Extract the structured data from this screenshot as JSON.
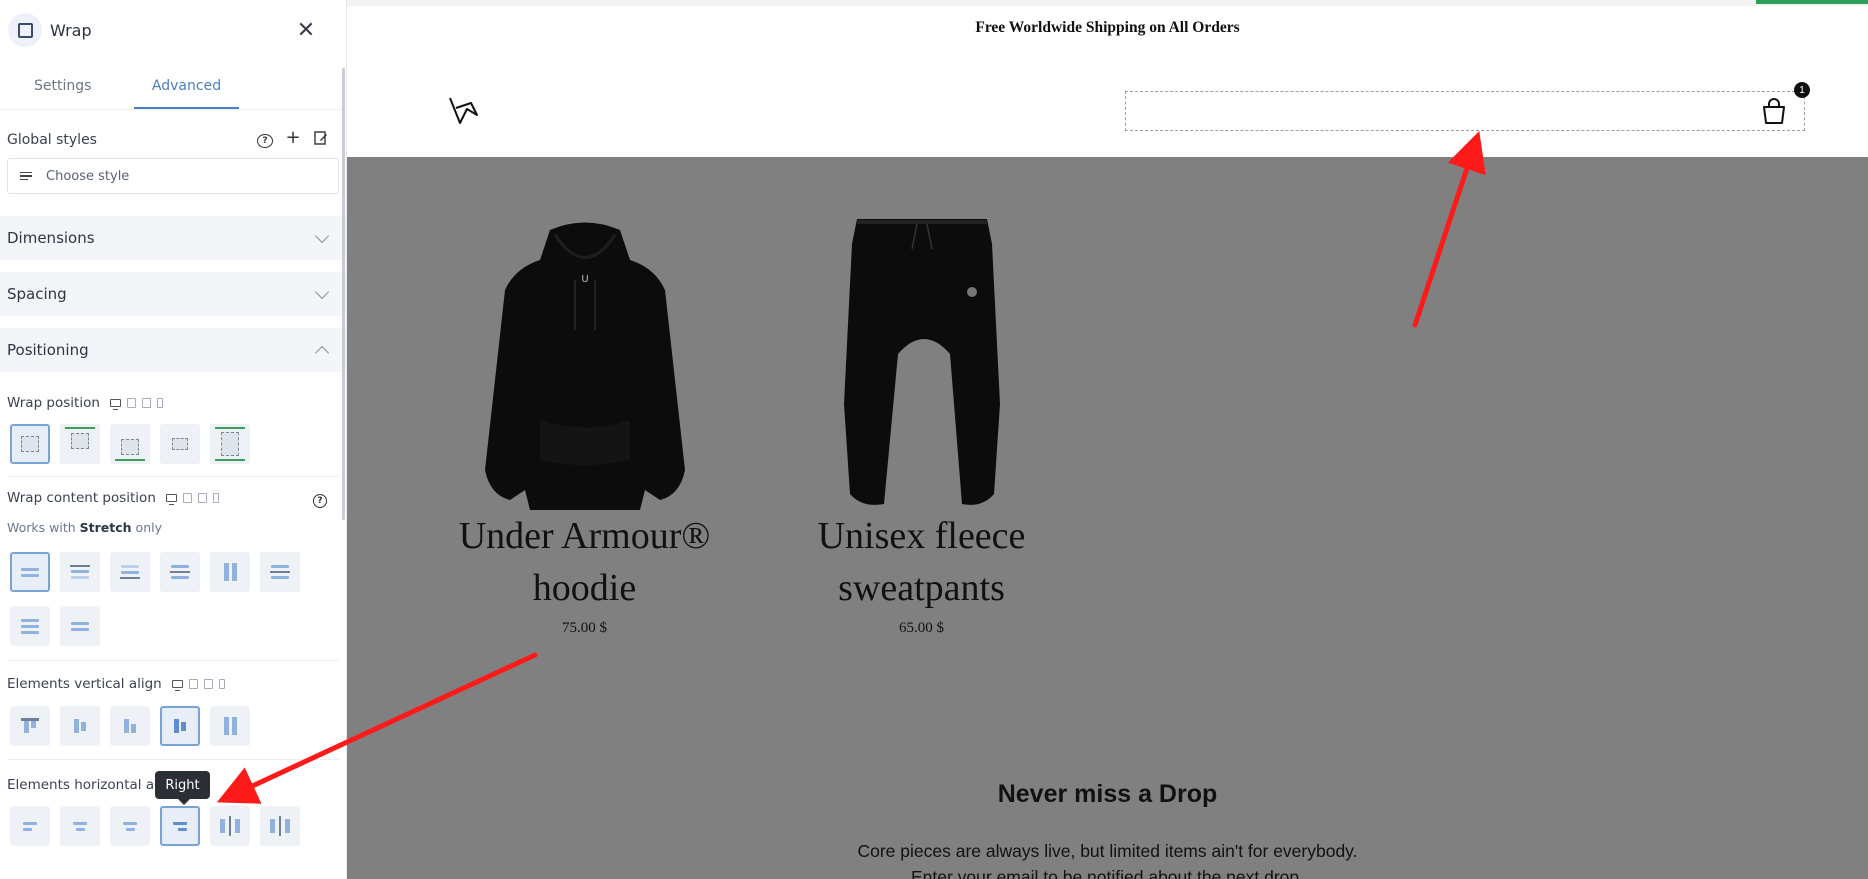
{
  "panel": {
    "title": "Wrap",
    "tabs": [
      "Settings",
      "Advanced"
    ],
    "active_tab": "Advanced",
    "global_styles": {
      "label": "Global styles",
      "placeholder": "Choose style"
    },
    "sections": {
      "dimensions": "Dimensions",
      "spacing": "Spacing",
      "positioning": "Positioning"
    },
    "wrap_position": {
      "label": "Wrap position"
    },
    "wrap_content_position": {
      "label": "Wrap content position",
      "note_prefix": "Works with",
      "note_bold": "Stretch",
      "note_suffix": "only"
    },
    "elements_vertical_align": {
      "label": "Elements vertical align"
    },
    "elements_horizontal_align": {
      "label": "Elements horizontal align"
    },
    "tooltip": "Right"
  },
  "page": {
    "announcement": "Free Worldwide Shipping on All Orders",
    "cart_count": "1",
    "products": [
      {
        "title_line1": "Under Armour®",
        "title_line2": "hoodie",
        "price": "75.00 $"
      },
      {
        "title_line1": "Unisex fleece",
        "title_line2": "sweatpants",
        "price": "65.00 $"
      }
    ],
    "newsletter": {
      "title": "Never miss a Drop",
      "line1": "Core pieces are always live, but limited items ain't for everybody.",
      "line2": "Enter your email to be notified about the next drop."
    }
  },
  "colors": {
    "accent": "#4a7fc1",
    "annotation_arrow": "#ff1a1a",
    "canvas_overlay": "#808080"
  }
}
